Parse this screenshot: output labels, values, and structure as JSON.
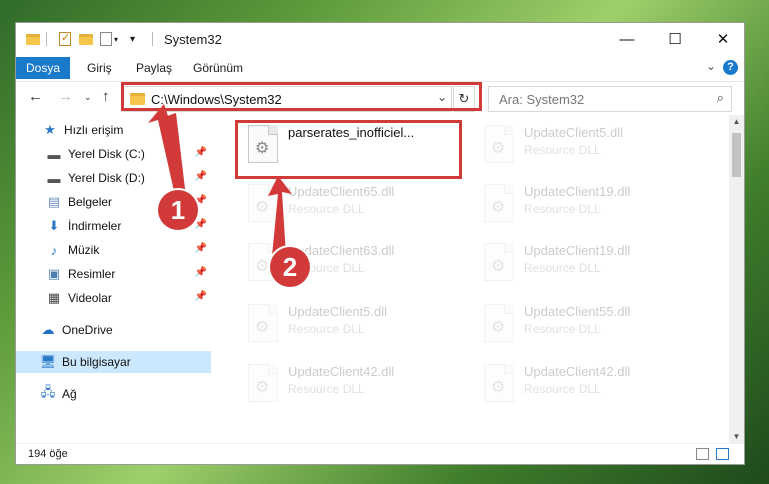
{
  "window": {
    "title": "System32",
    "controls": {
      "minimize": "—",
      "maximize": "☐",
      "close": "✕"
    }
  },
  "ribbon": {
    "tabs": [
      "Dosya",
      "Giriş",
      "Paylaş",
      "Görünüm"
    ],
    "help": "?"
  },
  "address": {
    "path": "C:\\Windows\\System32",
    "search_placeholder": "Ara: System32"
  },
  "nav": {
    "items": [
      {
        "label": "Hızlı erişim",
        "icon": "star-icon"
      },
      {
        "label": "Yerel Disk (C:)",
        "icon": "drive-icon"
      },
      {
        "label": "Yerel Disk (D:)",
        "icon": "drive-icon"
      },
      {
        "label": "Belgeler",
        "icon": "documents-icon"
      },
      {
        "label": "İndirmeler",
        "icon": "download-icon"
      },
      {
        "label": "Müzik",
        "icon": "music-icon"
      },
      {
        "label": "Resimler",
        "icon": "pictures-icon"
      },
      {
        "label": "Videolar",
        "icon": "video-icon"
      },
      {
        "label": "OneDrive",
        "icon": "cloud-icon"
      },
      {
        "label": "Bu bilgisayar",
        "icon": "computer-icon"
      },
      {
        "label": "Ağ",
        "icon": "network-icon"
      }
    ]
  },
  "files": [
    {
      "name": "parserates_inofficiel...",
      "type": ""
    },
    {
      "name": "UpdateClient5.dll",
      "type": "Resource DLL"
    },
    {
      "name": "UpdateClient65.dll",
      "type": "Resource DLL"
    },
    {
      "name": "UpdateClient19.dll",
      "type": "Resource DLL"
    },
    {
      "name": "UpdateClient63.dll",
      "type": "Resource DLL"
    },
    {
      "name": "UpdateClient19.dll",
      "type": "Resource DLL"
    },
    {
      "name": "UpdateClient5.dll",
      "type": "Resource DLL"
    },
    {
      "name": "UpdateClient55.dll",
      "type": "Resource DLL"
    },
    {
      "name": "UpdateClient42.dll",
      "type": "Resource DLL"
    },
    {
      "name": "UpdateClient42.dll",
      "type": "Resource DLL"
    }
  ],
  "status": {
    "count": "194 öğe"
  },
  "annotations": {
    "step1": "1",
    "step2": "2",
    "color": "#d23a3a"
  }
}
